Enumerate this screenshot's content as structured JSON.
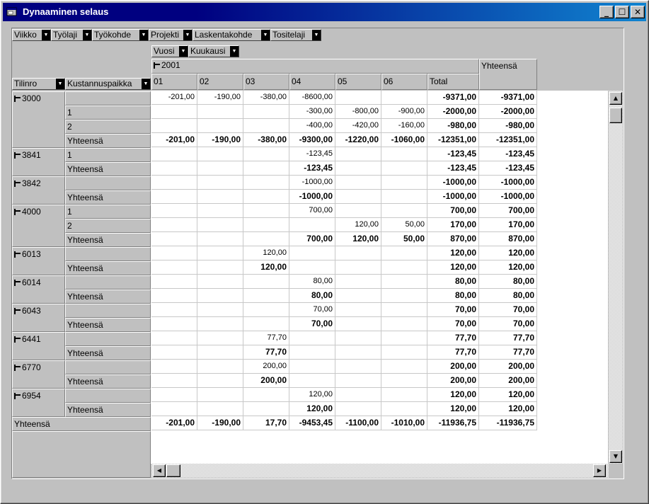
{
  "window": {
    "title": "Dynaaminen selaus"
  },
  "page_fields": [
    {
      "label": "Viikko"
    },
    {
      "label": "Työlaji"
    },
    {
      "label": "Työkohde"
    },
    {
      "label": "Projekti"
    },
    {
      "label": "Laskentakohde"
    },
    {
      "label": "Tositelaji"
    }
  ],
  "column_fields": [
    {
      "label": "Vuosi"
    },
    {
      "label": "Kuukausi"
    }
  ],
  "row_fields": [
    {
      "label": "Tilinro"
    },
    {
      "label": "Kustannuspaikka"
    }
  ],
  "year_label": "2001",
  "months": [
    "01",
    "02",
    "03",
    "04",
    "05",
    "06"
  ],
  "total_label": "Total",
  "grand_col_label": "Yhteensä",
  "grand_row_label": "Yhteensä",
  "subtotal_label": "Yhteensä",
  "groups": [
    {
      "account": "3000",
      "rows": [
        {
          "sub": "",
          "values": [
            "-201,00",
            "-190,00",
            "-380,00",
            "-8600,00",
            "",
            ""
          ],
          "total": "-9371,00",
          "grand": "-9371,00"
        },
        {
          "sub": "1",
          "values": [
            "",
            "",
            "",
            "-300,00",
            "-800,00",
            "-900,00"
          ],
          "total": "-2000,00",
          "grand": "-2000,00"
        },
        {
          "sub": "2",
          "values": [
            "",
            "",
            "",
            "-400,00",
            "-420,00",
            "-160,00"
          ],
          "total": "-980,00",
          "grand": "-980,00"
        },
        {
          "sub": "Yhteensä",
          "bold": true,
          "values": [
            "-201,00",
            "-190,00",
            "-380,00",
            "-9300,00",
            "-1220,00",
            "-1060,00"
          ],
          "total": "-12351,00",
          "grand": "-12351,00"
        }
      ]
    },
    {
      "account": "3841",
      "rows": [
        {
          "sub": "1",
          "values": [
            "",
            "",
            "",
            "-123,45",
            "",
            ""
          ],
          "total": "-123,45",
          "grand": "-123,45"
        },
        {
          "sub": "Yhteensä",
          "bold": true,
          "values": [
            "",
            "",
            "",
            "-123,45",
            "",
            ""
          ],
          "total": "-123,45",
          "grand": "-123,45"
        }
      ]
    },
    {
      "account": "3842",
      "rows": [
        {
          "sub": "",
          "values": [
            "",
            "",
            "",
            "-1000,00",
            "",
            ""
          ],
          "total": "-1000,00",
          "grand": "-1000,00"
        },
        {
          "sub": "Yhteensä",
          "bold": true,
          "values": [
            "",
            "",
            "",
            "-1000,00",
            "",
            ""
          ],
          "total": "-1000,00",
          "grand": "-1000,00"
        }
      ]
    },
    {
      "account": "4000",
      "rows": [
        {
          "sub": "1",
          "values": [
            "",
            "",
            "",
            "700,00",
            "",
            ""
          ],
          "total": "700,00",
          "grand": "700,00"
        },
        {
          "sub": "2",
          "values": [
            "",
            "",
            "",
            "",
            "120,00",
            "50,00"
          ],
          "total": "170,00",
          "grand": "170,00"
        },
        {
          "sub": "Yhteensä",
          "bold": true,
          "values": [
            "",
            "",
            "",
            "700,00",
            "120,00",
            "50,00"
          ],
          "total": "870,00",
          "grand": "870,00"
        }
      ]
    },
    {
      "account": "6013",
      "rows": [
        {
          "sub": "",
          "values": [
            "",
            "",
            "120,00",
            "",
            "",
            ""
          ],
          "total": "120,00",
          "grand": "120,00"
        },
        {
          "sub": "Yhteensä",
          "bold": true,
          "values": [
            "",
            "",
            "120,00",
            "",
            "",
            ""
          ],
          "total": "120,00",
          "grand": "120,00"
        }
      ]
    },
    {
      "account": "6014",
      "rows": [
        {
          "sub": "",
          "values": [
            "",
            "",
            "",
            "80,00",
            "",
            ""
          ],
          "total": "80,00",
          "grand": "80,00"
        },
        {
          "sub": "Yhteensä",
          "bold": true,
          "values": [
            "",
            "",
            "",
            "80,00",
            "",
            ""
          ],
          "total": "80,00",
          "grand": "80,00"
        }
      ]
    },
    {
      "account": "6043",
      "rows": [
        {
          "sub": "",
          "values": [
            "",
            "",
            "",
            "70,00",
            "",
            ""
          ],
          "total": "70,00",
          "grand": "70,00"
        },
        {
          "sub": "Yhteensä",
          "bold": true,
          "values": [
            "",
            "",
            "",
            "70,00",
            "",
            ""
          ],
          "total": "70,00",
          "grand": "70,00"
        }
      ]
    },
    {
      "account": "6441",
      "rows": [
        {
          "sub": "",
          "values": [
            "",
            "",
            "77,70",
            "",
            "",
            ""
          ],
          "total": "77,70",
          "grand": "77,70"
        },
        {
          "sub": "Yhteensä",
          "bold": true,
          "values": [
            "",
            "",
            "77,70",
            "",
            "",
            ""
          ],
          "total": "77,70",
          "grand": "77,70"
        }
      ]
    },
    {
      "account": "6770",
      "rows": [
        {
          "sub": "",
          "values": [
            "",
            "",
            "200,00",
            "",
            "",
            ""
          ],
          "total": "200,00",
          "grand": "200,00"
        },
        {
          "sub": "Yhteensä",
          "bold": true,
          "values": [
            "",
            "",
            "200,00",
            "",
            "",
            ""
          ],
          "total": "200,00",
          "grand": "200,00"
        }
      ]
    },
    {
      "account": "6954",
      "rows": [
        {
          "sub": "",
          "values": [
            "",
            "",
            "",
            "120,00",
            "",
            ""
          ],
          "total": "120,00",
          "grand": "120,00"
        },
        {
          "sub": "Yhteensä",
          "bold": true,
          "values": [
            "",
            "",
            "",
            "120,00",
            "",
            ""
          ],
          "total": "120,00",
          "grand": "120,00"
        }
      ]
    }
  ],
  "grand_total_row": {
    "values": [
      "-201,00",
      "-190,00",
      "17,70",
      "-9453,45",
      "-1100,00",
      "-1010,00"
    ],
    "total": "-11936,75",
    "grand": "-11936,75"
  },
  "icons": {
    "app": "app-window-icon",
    "minimize": "minimize-icon",
    "maximize": "maximize-icon",
    "close": "close-icon",
    "dropdown": "dropdown-arrow-icon",
    "collapse": "collapse-minus-icon"
  }
}
